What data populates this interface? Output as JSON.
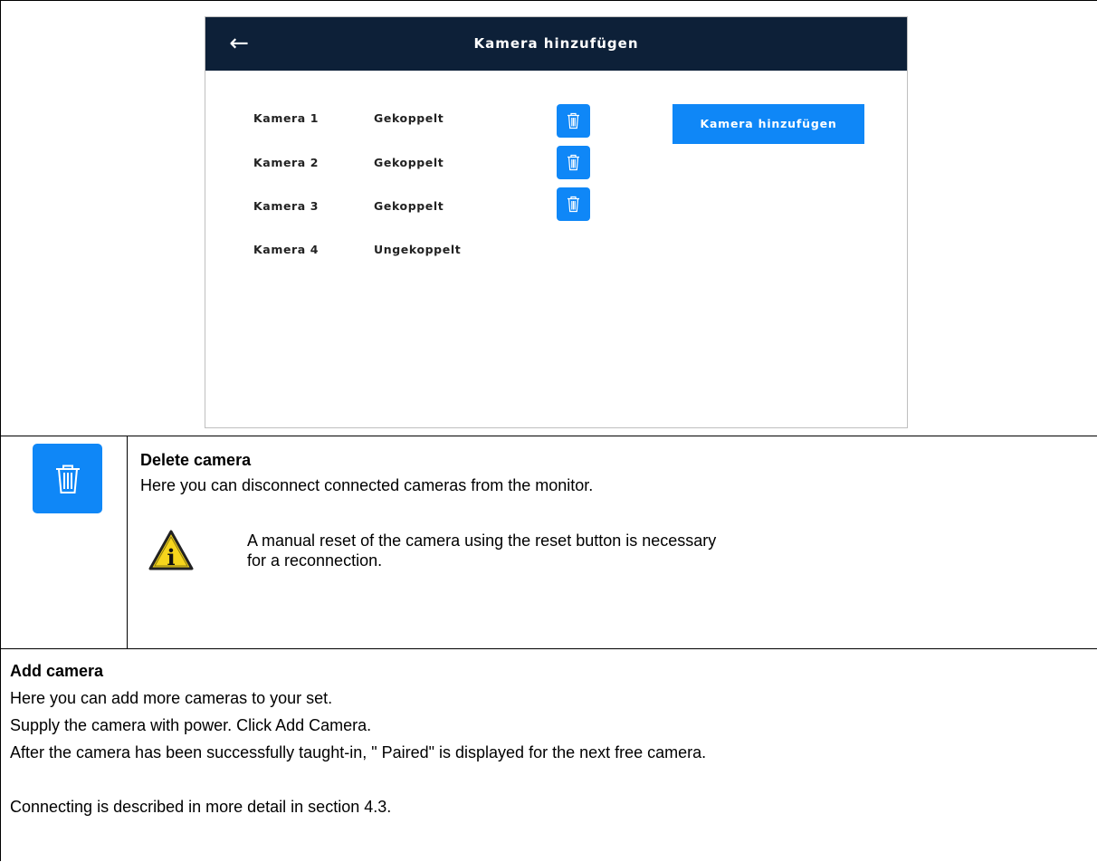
{
  "screen": {
    "back_label": "←",
    "title": "Kamera hinzufügen",
    "cameras": [
      {
        "name": "Kamera 1",
        "status": "Gekoppelt",
        "has_delete": true
      },
      {
        "name": "Kamera 2",
        "status": "Gekoppelt",
        "has_delete": true
      },
      {
        "name": "Kamera 3",
        "status": "Gekoppelt",
        "has_delete": true
      },
      {
        "name": "Kamera 4",
        "status": "Ungekoppelt",
        "has_delete": false
      }
    ],
    "add_button_label": "Kamera hinzufügen",
    "accent_color": "#0f87f7",
    "header_color": "#0d2038"
  },
  "delete_section": {
    "icon": "trash-icon",
    "heading": "Delete camera",
    "text": "Here you can disconnect connected cameras from the monitor.",
    "note_icon": "info-warning-icon",
    "note_line1": "A manual reset of the camera using the reset button is necessary",
    "note_line2": "for a reconnection."
  },
  "add_section": {
    "heading": "Add camera",
    "line1": "Here you can add more cameras to your set.",
    "line2": "Supply the camera with power. Click Add Camera.",
    "line3": "After the camera has been successfully taught-in, \" Paired\" is displayed for the next free camera.",
    "line4": "Connecting is described in more detail in section 4.3."
  }
}
